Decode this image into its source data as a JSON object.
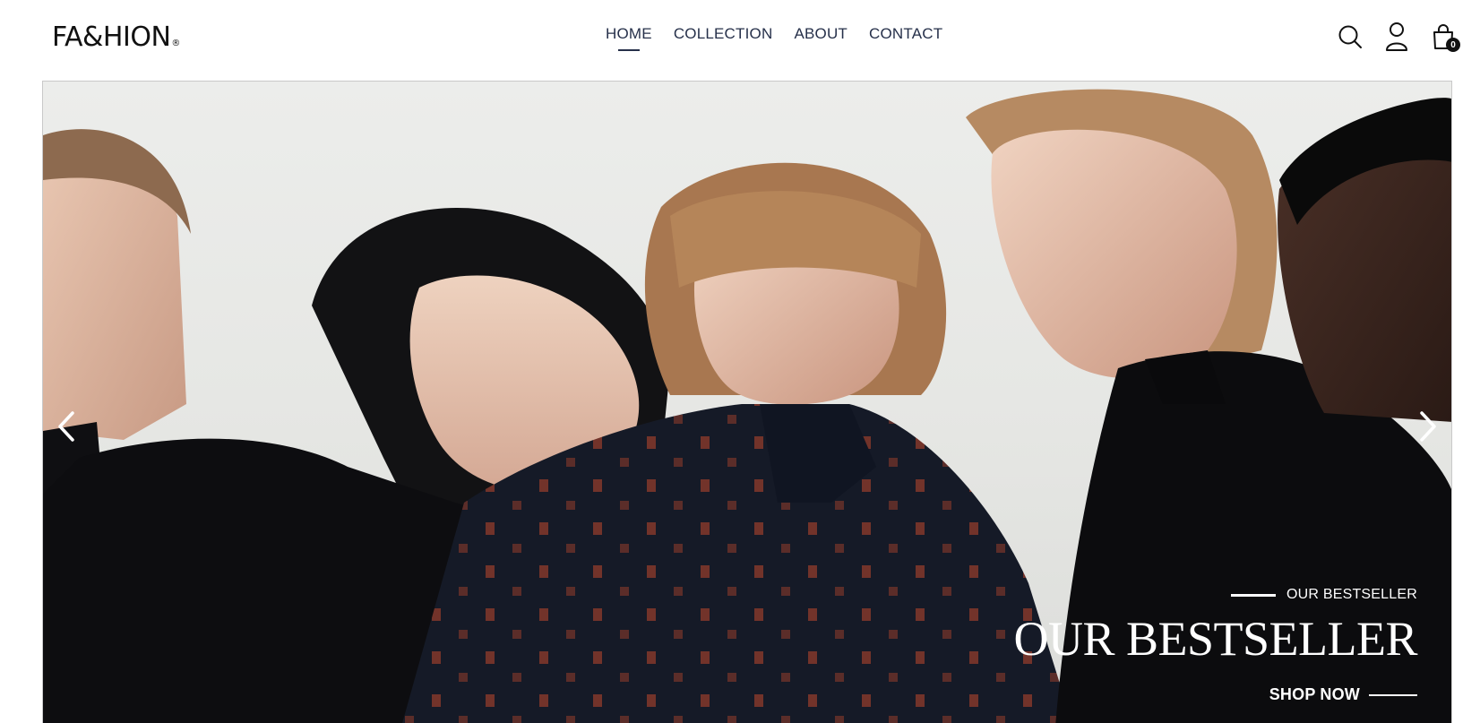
{
  "brand": {
    "logo_text": "FA&HION",
    "logo_mark": "®"
  },
  "nav": {
    "items": [
      {
        "label": "HOME",
        "active": true
      },
      {
        "label": "COLLECTION",
        "active": false
      },
      {
        "label": "ABOUT",
        "active": false
      },
      {
        "label": "CONTACT",
        "active": false
      }
    ]
  },
  "header_icons": {
    "search": "search-icon",
    "account": "user-icon",
    "cart": "shopping-bag-icon",
    "cart_count": "0"
  },
  "hero": {
    "eyebrow": "OUR BESTSELLER",
    "headline": "OUR BESTSELLER",
    "cta": "SHOP NOW",
    "prev_icon": "chevron-left-icon",
    "next_icon": "chevron-right-icon",
    "image": "fashion-models-photo"
  },
  "colors": {
    "nav_text": "#26304a",
    "logo": "#111111",
    "caption_text": "#ffffff"
  }
}
